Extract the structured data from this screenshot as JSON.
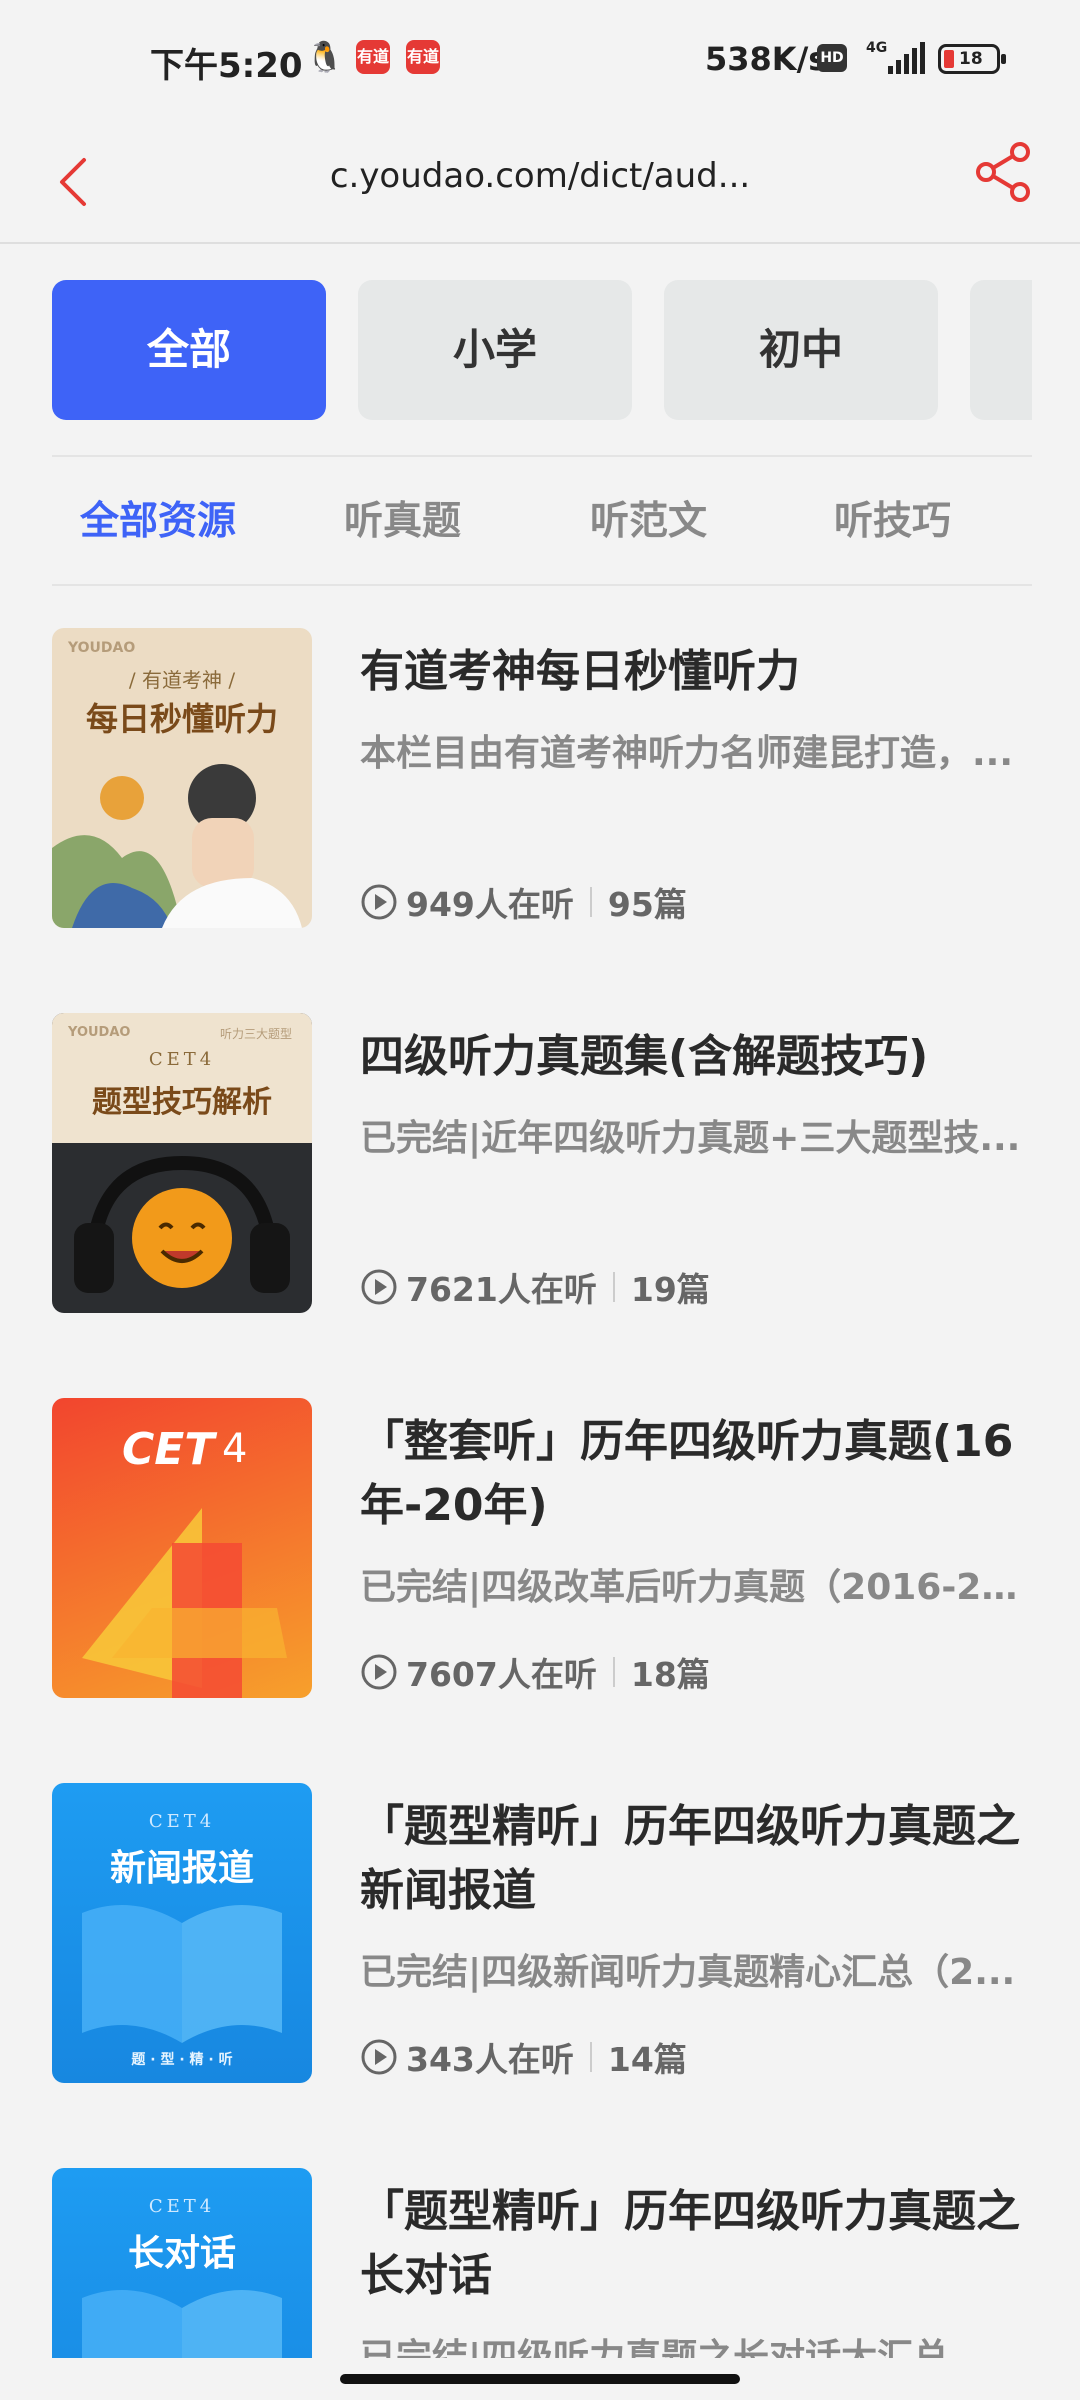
{
  "status": {
    "time": "下午5:20",
    "app_icon_1": "有道",
    "app_icon_2": "有道",
    "net_speed": "538K/s",
    "hd": "HD",
    "signal": "4G",
    "battery": "18"
  },
  "nav": {
    "url": "c.youdao.com/dict/aud..."
  },
  "categories": [
    "全部",
    "小学",
    "初中"
  ],
  "subtabs": [
    "全部资源",
    "听真题",
    "听范文",
    "听技巧"
  ],
  "items": [
    {
      "title": "有道考神每日秒懂听力",
      "desc": "本栏目由有道考神听力名师建昆打造，...",
      "listeners": "949人在听",
      "episodes": "95篇",
      "cover": {
        "brand": "YOUDAO",
        "sub": "/ 有道考神 /",
        "main": "每日秒懂听力"
      }
    },
    {
      "title": "四级听力真题集(含解题技巧)",
      "desc": "已完结|近年四级听力真题+三大题型技...",
      "listeners": "7621人在听",
      "episodes": "19篇",
      "cover": {
        "brand": "YOUDAO",
        "corner": "听力三大题型",
        "sub": "CET4",
        "main": "题型技巧解析"
      }
    },
    {
      "title": "「整套听」历年四级听力真题(16年-20年)",
      "desc": "已完结|四级改革后听力真题（2016-20...",
      "listeners": "7607人在听",
      "episodes": "18篇",
      "cover": {
        "main": "CET",
        "num": "4"
      }
    },
    {
      "title": "「题型精听」历年四级听力真题之新闻报道",
      "desc": "已完结|四级新闻听力真题精心汇总（2...",
      "listeners": "343人在听",
      "episodes": "14篇",
      "cover": {
        "sub": "CET4",
        "main": "新闻报道",
        "foot": "题 · 型 · 精 · 听"
      }
    },
    {
      "title": "「题型精听」历年四级听力真题之长对话",
      "desc": "已完结|四级听力真题之长对话大汇总",
      "listeners": "",
      "episodes": "",
      "cover": {
        "sub": "CET4",
        "main": "长对话"
      }
    }
  ],
  "colors": {
    "accent": "#3e63f7",
    "share": "#e53935"
  }
}
